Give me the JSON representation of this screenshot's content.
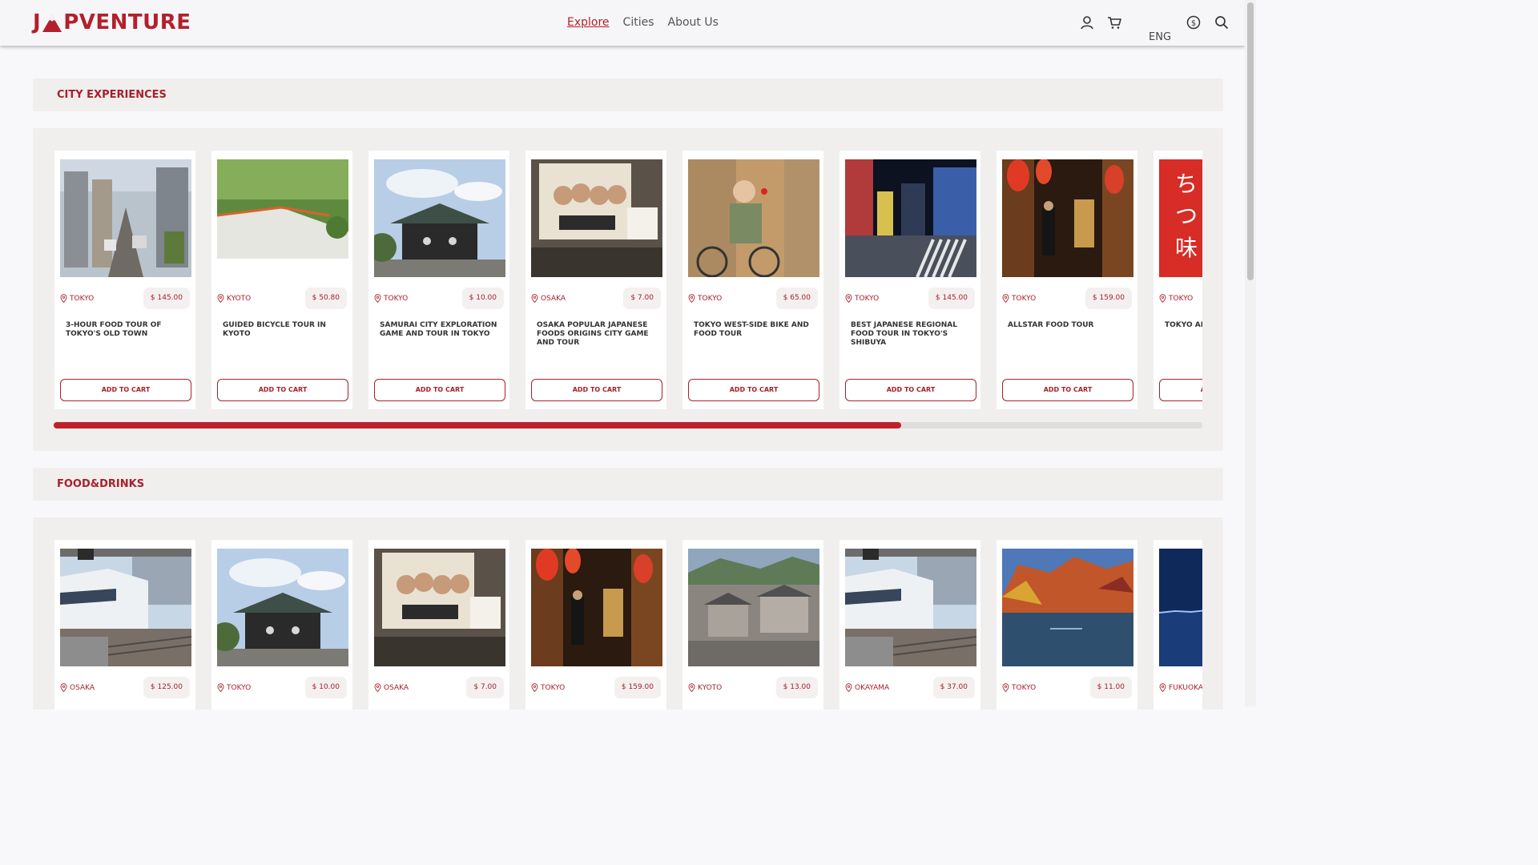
{
  "header": {
    "logo": {
      "left": "J",
      "right": "PVENTURE"
    },
    "nav": [
      {
        "label": "Explore",
        "active": true
      },
      {
        "label": "Cities",
        "active": false
      },
      {
        "label": "About Us",
        "active": false
      }
    ],
    "language": "ENG",
    "icons": [
      "user-icon",
      "cart-icon",
      "currency-icon",
      "search-icon"
    ]
  },
  "colors": {
    "accent": "#b3202b",
    "section_bg": "#f1eeee",
    "page_bg": "#f8f8fb"
  },
  "sections": [
    {
      "title": "CITY EXPERIENCES",
      "progress_fraction": 0.738,
      "cards": [
        {
          "location": "TOKYO",
          "price": "$ 145.00",
          "title": "3-HOUR FOOD TOUR OF TOKYO'S OLD TOWN",
          "button": "ADD TO CART",
          "image": "street-market"
        },
        {
          "location": "KYOTO",
          "price": "$ 50.80",
          "title": "GUIDED BICYCLE TOUR IN KYOTO",
          "button": "ADD TO CART",
          "image": "green-path"
        },
        {
          "location": "TOKYO",
          "price": "$ 10.00",
          "title": "SAMURAI CITY EXPLORATION GAME AND TOUR IN TOKYO",
          "button": "ADD TO CART",
          "image": "shrine"
        },
        {
          "location": "OSAKA",
          "price": "$ 7.00",
          "title": "OSAKA POPULAR JAPANESE FOODS ORIGINS CITY GAME AND TOUR",
          "button": "ADD TO CART",
          "image": "restaurant-sign"
        },
        {
          "location": "TOKYO",
          "price": "$ 65.00",
          "title": "TOKYO WEST-SIDE BIKE AND FOOD TOUR",
          "button": "ADD TO CART",
          "image": "cyclist"
        },
        {
          "location": "TOKYO",
          "price": "$ 145.00",
          "title": "BEST JAPANESE REGIONAL FOOD TOUR IN TOKYO'S SHIBUYA",
          "button": "ADD TO CART",
          "image": "night-crossing"
        },
        {
          "location": "TOKYO",
          "price": "$ 159.00",
          "title": "ALLSTAR FOOD TOUR",
          "button": "ADD TO CART",
          "image": "lantern-alley"
        },
        {
          "location": "TOKYO",
          "price": "",
          "title": "TOKYO AF WALKING",
          "button": "ADD TO CART",
          "image": "red-lantern"
        }
      ]
    },
    {
      "title": "FOOD&DRINKS",
      "cards": [
        {
          "location": "OSAKA",
          "price": "$ 125.00",
          "image": "train"
        },
        {
          "location": "TOKYO",
          "price": "$ 10.00",
          "image": "shrine"
        },
        {
          "location": "OSAKA",
          "price": "$ 7.00",
          "image": "restaurant-sign"
        },
        {
          "location": "TOKYO",
          "price": "$ 159.00",
          "image": "lantern-alley"
        },
        {
          "location": "KYOTO",
          "price": "$ 13.00",
          "image": "old-town"
        },
        {
          "location": "OKAYAMA",
          "price": "$ 37.00",
          "image": "train"
        },
        {
          "location": "TOKYO",
          "price": "$ 11.00",
          "image": "autumn-river"
        },
        {
          "location": "FUKUOKA",
          "price": "",
          "image": "night-bay"
        }
      ]
    }
  ]
}
